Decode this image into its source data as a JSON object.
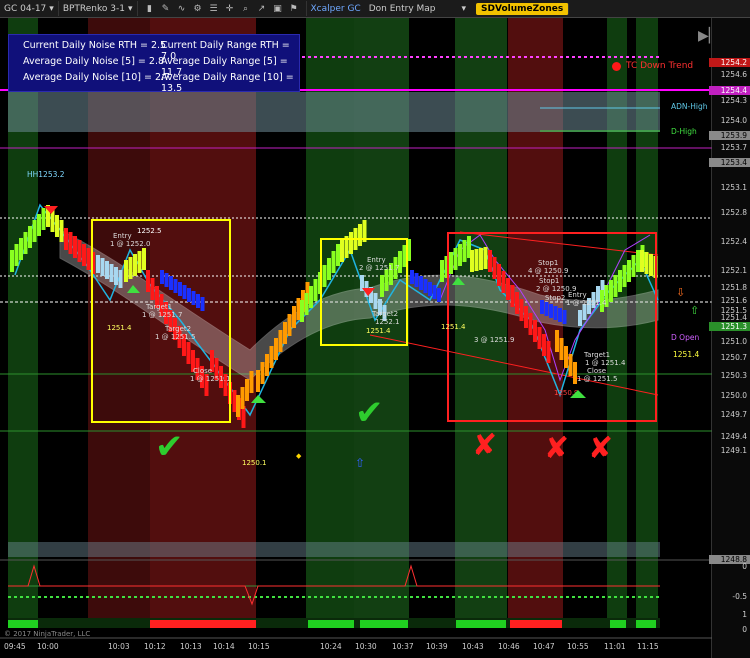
{
  "toolbar": {
    "instrument": "GC 04-17",
    "chart_type": "BPTRenko 3-1",
    "strategy": "Xcalper GC",
    "map": "Don Entry Map",
    "zones_button": "SDVolumeZones"
  },
  "info_panel": {
    "line1a": "Current Daily Noise RTH = 2.5",
    "line1b": "Current Daily Range RTH = 7.0",
    "line2a": "Average Daily Noise [5] = 2.8",
    "line2b": "Average Daily Range [5] = 11.7",
    "line3a": "Average Daily Noise [10] = 2.7",
    "line3b": "Average Daily Range [10] = 13.5"
  },
  "trend_label": "TC Down Trend",
  "copyright": "© 2017 NinjaTrader, LLC",
  "level_labels": {
    "adn_high": "ADN-High",
    "d_high": "D-High",
    "d_open": "D Open",
    "d_open_value": "1251.4",
    "hh_label": "HH1253.2",
    "low_label": "1250.1",
    "low2_label": "1250.3"
  },
  "price_axis": [
    "1254.6",
    "1254.3",
    "1254.0",
    "1253.9",
    "1253.7",
    "1253.4",
    "1253.1",
    "1252.8",
    "1252.4",
    "1252.1",
    "1251.8",
    "1251.6",
    "1251.5",
    "1251.4",
    "1251.3",
    "1251.0",
    "1250.7",
    "1250.3",
    "1250.0",
    "1249.7",
    "1249.4",
    "1249.1",
    "1248.8"
  ],
  "highlight_prices": {
    "red": "1254.2",
    "magenta": "1254.4"
  },
  "time_axis": [
    "09:45",
    "10:00",
    "10:03",
    "10:12",
    "10:13",
    "10:14",
    "10:15",
    "10:24",
    "10:30",
    "10:37",
    "10:39",
    "10:43",
    "10:46",
    "10:47",
    "10:55",
    "11:01",
    "11:15"
  ],
  "osc_axis": [
    "0",
    "-0.5",
    "1",
    "0"
  ],
  "annotations": {
    "box1": [
      {
        "text": "Entry"
      },
      {
        "text": "1 @ 1252.0"
      },
      {
        "text": "1252.5"
      },
      {
        "text": "Target1"
      },
      {
        "text": "1 @ 1251.7"
      },
      {
        "text": "Target2"
      },
      {
        "text": "1 @ 1251.5"
      },
      {
        "text": "Close"
      },
      {
        "text": "1 @ 1251.1"
      },
      {
        "text": "1251.4"
      }
    ],
    "box2": [
      {
        "text": "Entry"
      },
      {
        "text": "2 @ 1251.7"
      },
      {
        "text": "Target2"
      },
      {
        "text": "1252.1"
      },
      {
        "text": "1251.4"
      }
    ],
    "box3": [
      {
        "text": "Stop1"
      },
      {
        "text": "4 @ 1250.9"
      },
      {
        "text": "Stop1"
      },
      {
        "text": "2 @ 1250.9"
      },
      {
        "text": "Stop2"
      },
      {
        "text": "Entry"
      },
      {
        "text": "1 @ 1251.4"
      },
      {
        "text": "3 @ 1251.9"
      },
      {
        "text": "Target1"
      },
      {
        "text": "1 @ 1251.4"
      },
      {
        "text": "Close"
      },
      {
        "text": "1 @ 1251.5"
      },
      {
        "text": "1250.9"
      },
      {
        "text": "1251.4"
      }
    ]
  },
  "colors": {
    "background": "#000000",
    "session_green": "#0f3d0f",
    "session_red": "#4a0d0d",
    "box_yellow": "#ffff00",
    "box_red": "#ff2020",
    "magenta_line": "#ff00ff",
    "check_green": "#2ecc2e",
    "cross_red": "#ff2020"
  }
}
